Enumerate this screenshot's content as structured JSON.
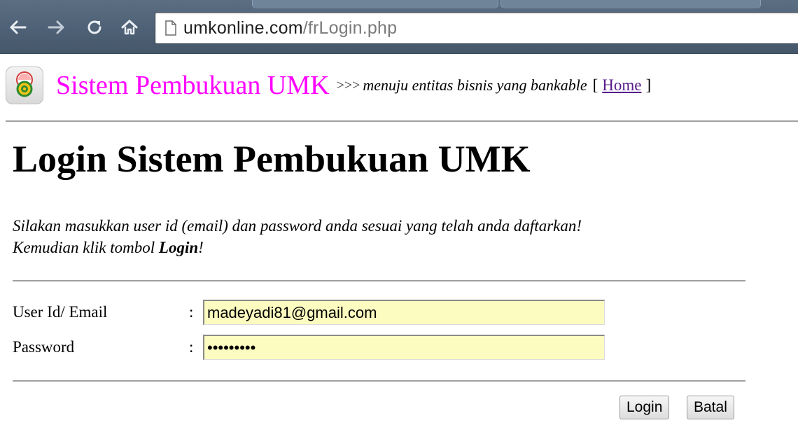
{
  "browser": {
    "back_icon": "back-arrow-icon",
    "forward_icon": "forward-arrow-icon",
    "reload_icon": "reload-icon",
    "home_icon": "home-icon",
    "page_icon": "page-icon",
    "url_host": "umkonline.com",
    "url_path": "/frLogin.php"
  },
  "header": {
    "logo_icon": "umk-logo-icon",
    "site_title": "Sistem Pembukuan UMK",
    "tagline_arrows": ">>>",
    "tagline": "menuju entitas bisnis yang bankable",
    "bracket_open": "[",
    "home_link": "Home",
    "bracket_close": "]"
  },
  "main": {
    "title": "Login Sistem Pembukuan UMK",
    "instruction_line1": "Silakan masukkan user id (email) dan password anda sesuai yang telah anda daftarkan!",
    "instruction_line2_prefix": "Kemudian klik tombol ",
    "instruction_line2_bold": "Login",
    "instruction_line2_suffix": "!"
  },
  "form": {
    "colon": ":",
    "email_label": "User Id/ Email",
    "email_value": "madeyadi81@gmail.com",
    "password_label": "Password",
    "password_value": "madeyadi8",
    "login_button": "Login",
    "cancel_button": "Batal"
  },
  "colors": {
    "site_title": "#ff00ff",
    "input_autofill": "#fcfcc0",
    "link_visited": "#551a8b",
    "browser_chrome": "#4e6176"
  }
}
